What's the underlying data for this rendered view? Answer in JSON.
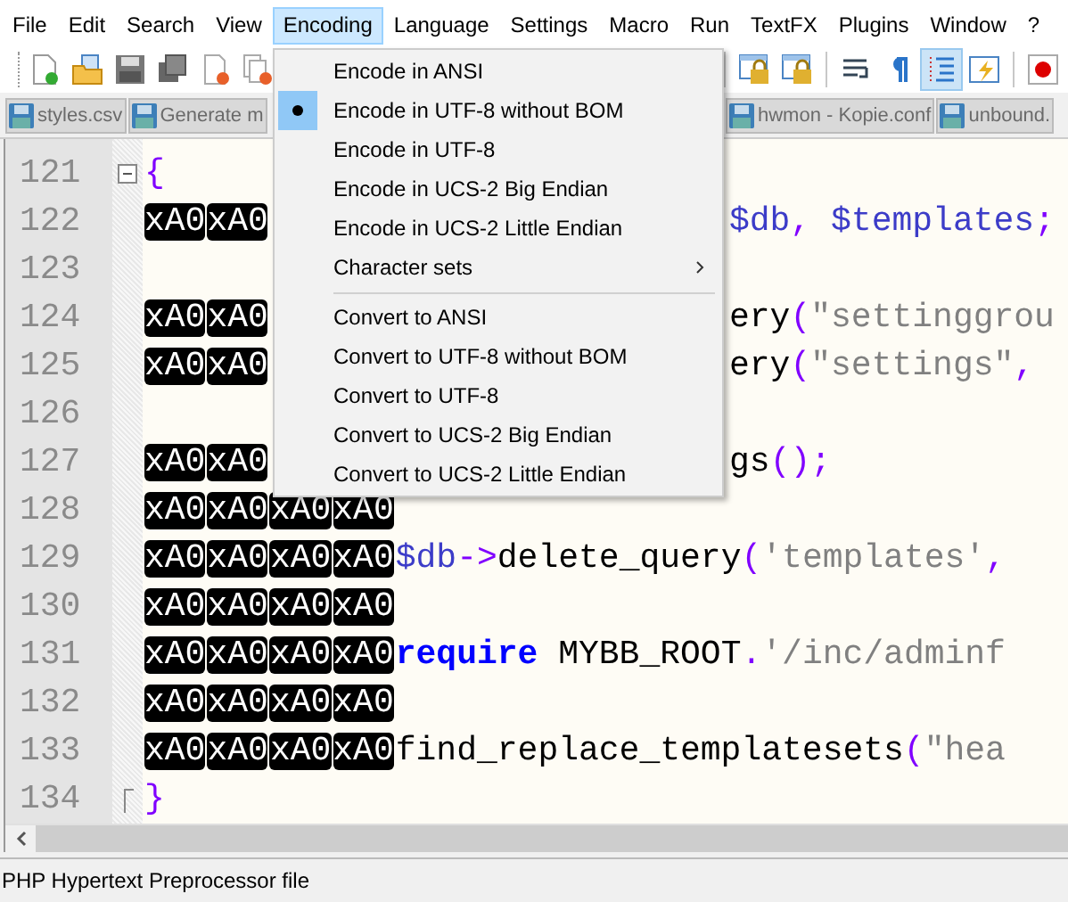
{
  "menu_bar": [
    {
      "label": "File",
      "selected": false
    },
    {
      "label": "Edit",
      "selected": false
    },
    {
      "label": "Search",
      "selected": false
    },
    {
      "label": "View",
      "selected": false
    },
    {
      "label": "Encoding",
      "selected": true
    },
    {
      "label": "Language",
      "selected": false
    },
    {
      "label": "Settings",
      "selected": false
    },
    {
      "label": "Macro",
      "selected": false
    },
    {
      "label": "Run",
      "selected": false
    },
    {
      "label": "TextFX",
      "selected": false
    },
    {
      "label": "Plugins",
      "selected": false
    },
    {
      "label": "Window",
      "selected": false
    },
    {
      "label": "?",
      "selected": false
    }
  ],
  "toolbar_buttons": [
    {
      "pressed": false
    },
    {
      "pressed": false
    },
    {
      "pressed": false
    },
    {
      "pressed": false
    },
    {
      "pressed": false
    },
    {
      "pressed": false
    },
    {
      "pressed": false
    },
    {
      "pressed": false
    },
    {
      "pressed": false
    },
    {
      "pressed": false
    },
    {
      "pressed": true
    },
    {
      "pressed": false
    },
    {
      "pressed": false
    }
  ],
  "tabs_left": [
    {
      "label": "styles.csv"
    },
    {
      "label": "Generate m"
    }
  ],
  "tabs_right": [
    {
      "label": "hwmon - Kopie.conf"
    },
    {
      "label": "unbound."
    }
  ],
  "encoding_menu": [
    {
      "kind": "item",
      "label": "Encode in ANSI",
      "selected": false
    },
    {
      "kind": "item",
      "label": "Encode in UTF-8 without BOM",
      "selected": true
    },
    {
      "kind": "item",
      "label": "Encode in UTF-8",
      "selected": false
    },
    {
      "kind": "item",
      "label": "Encode in UCS-2 Big Endian",
      "selected": false
    },
    {
      "kind": "item",
      "label": "Encode in UCS-2 Little Endian",
      "selected": false
    },
    {
      "kind": "submenu",
      "label": "Character sets",
      "selected": false
    },
    {
      "kind": "separator"
    },
    {
      "kind": "item",
      "label": "Convert to ANSI",
      "selected": false
    },
    {
      "kind": "item",
      "label": "Convert to UTF-8 without BOM",
      "selected": false
    },
    {
      "kind": "item",
      "label": "Convert to UTF-8",
      "selected": false
    },
    {
      "kind": "item",
      "label": "Convert to UCS-2 Big Endian",
      "selected": false
    },
    {
      "kind": "item",
      "label": "Convert to UCS-2 Little Endian",
      "selected": false
    }
  ],
  "editor_lines": [
    {
      "number": "121",
      "fold_start": true,
      "left": [
        {
          "kind": "op",
          "text": "{"
        }
      ]
    },
    {
      "number": "122",
      "left": [
        {
          "kind": "nbsp",
          "text": "xA0"
        },
        {
          "kind": "nbsp",
          "text": "xA0"
        }
      ],
      "right": [
        {
          "kind": "var",
          "text": "$db"
        },
        {
          "kind": "op",
          "text": ", "
        },
        {
          "kind": "var",
          "text": "$templates"
        },
        {
          "kind": "op",
          "text": ";"
        }
      ]
    },
    {
      "number": "123"
    },
    {
      "number": "124",
      "left": [
        {
          "kind": "nbsp",
          "text": "xA0"
        },
        {
          "kind": "nbsp",
          "text": "xA0"
        }
      ],
      "right": [
        {
          "kind": "ident",
          "text": "ery"
        },
        {
          "kind": "op",
          "text": "("
        },
        {
          "kind": "string",
          "text": "\"settinggrou"
        }
      ]
    },
    {
      "number": "125",
      "left": [
        {
          "kind": "nbsp",
          "text": "xA0"
        },
        {
          "kind": "nbsp",
          "text": "xA0"
        }
      ],
      "right": [
        {
          "kind": "ident",
          "text": "ery"
        },
        {
          "kind": "op",
          "text": "("
        },
        {
          "kind": "string",
          "text": "\"settings\""
        },
        {
          "kind": "op",
          "text": ","
        }
      ]
    },
    {
      "number": "126"
    },
    {
      "number": "127",
      "left": [
        {
          "kind": "nbsp",
          "text": "xA0"
        },
        {
          "kind": "nbsp",
          "text": "xA0"
        }
      ],
      "right": [
        {
          "kind": "ident",
          "text": "gs"
        },
        {
          "kind": "op",
          "text": "();"
        }
      ]
    },
    {
      "number": "128",
      "left": [
        {
          "kind": "nbsp",
          "text": "xA0"
        },
        {
          "kind": "nbsp",
          "text": "xA0"
        },
        {
          "kind": "nbsp",
          "text": "xA0"
        },
        {
          "kind": "nbsp",
          "text": "xA0"
        }
      ]
    },
    {
      "number": "129",
      "left": [
        {
          "kind": "nbsp",
          "text": "xA0"
        },
        {
          "kind": "nbsp",
          "text": "xA0"
        },
        {
          "kind": "nbsp",
          "text": "xA0"
        },
        {
          "kind": "nbsp",
          "text": "xA0"
        },
        {
          "kind": "var",
          "text": "$db"
        },
        {
          "kind": "op",
          "text": "->"
        },
        {
          "kind": "ident",
          "text": "delete_query"
        },
        {
          "kind": "op",
          "text": "("
        },
        {
          "kind": "string",
          "text": "'templates'"
        },
        {
          "kind": "op",
          "text": ","
        }
      ]
    },
    {
      "number": "130",
      "left": [
        {
          "kind": "nbsp",
          "text": "xA0"
        },
        {
          "kind": "nbsp",
          "text": "xA0"
        },
        {
          "kind": "nbsp",
          "text": "xA0"
        },
        {
          "kind": "nbsp",
          "text": "xA0"
        }
      ]
    },
    {
      "number": "131",
      "left": [
        {
          "kind": "nbsp",
          "text": "xA0"
        },
        {
          "kind": "nbsp",
          "text": "xA0"
        },
        {
          "kind": "nbsp",
          "text": "xA0"
        },
        {
          "kind": "nbsp",
          "text": "xA0"
        },
        {
          "kind": "keyword",
          "text": "require"
        },
        {
          "kind": "ident",
          "text": " MYBB_ROOT"
        },
        {
          "kind": "op",
          "text": "."
        },
        {
          "kind": "string",
          "text": "'/inc/adminf"
        }
      ]
    },
    {
      "number": "132",
      "left": [
        {
          "kind": "nbsp",
          "text": "xA0"
        },
        {
          "kind": "nbsp",
          "text": "xA0"
        },
        {
          "kind": "nbsp",
          "text": "xA0"
        },
        {
          "kind": "nbsp",
          "text": "xA0"
        }
      ]
    },
    {
      "number": "133",
      "left": [
        {
          "kind": "nbsp",
          "text": "xA0"
        },
        {
          "kind": "nbsp",
          "text": "xA0"
        },
        {
          "kind": "nbsp",
          "text": "xA0"
        },
        {
          "kind": "nbsp",
          "text": "xA0"
        },
        {
          "kind": "ident",
          "text": "find_replace_templatesets"
        },
        {
          "kind": "op",
          "text": "("
        },
        {
          "kind": "string",
          "text": "\"hea"
        }
      ]
    },
    {
      "number": "134",
      "fold_end": true,
      "left": [
        {
          "kind": "op",
          "text": "}"
        }
      ]
    }
  ],
  "status_bar": {
    "file_type": "PHP Hypertext Preprocessor file"
  }
}
